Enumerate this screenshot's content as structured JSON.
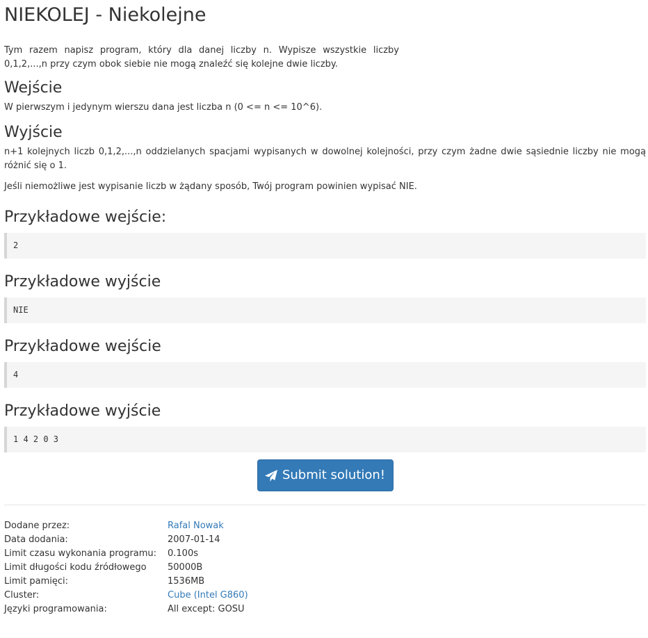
{
  "problem": {
    "title": "NIEKOLEJ - Niekolejne",
    "statement_line1": "Tym razem napisz program, który dla danej liczby n. Wypisze wszystkie liczby",
    "statement_line2": "0,1,2,...,n przy czym obok siebie nie mogą znaleźć się kolejne dwie liczby."
  },
  "input_section": {
    "heading": "Wejście",
    "text": "W pierwszym i jedynym wierszu dana jest liczba n (0 <= n <= 10^6)."
  },
  "output_section": {
    "heading": "Wyjście",
    "text1": "n+1 kolejnych liczb 0,1,2,...,n oddzielanych spacjami wypisanych w dowolnej kolejności, przy czym żadne dwie sąsiednie liczby nie mogą różnić się o 1.",
    "text2": "Jeśli niemożliwe jest wypisanie liczb w żądany sposób, Twój program powinien wypisać NIE."
  },
  "examples": [
    {
      "heading": "Przykładowe wejście:",
      "content": "2"
    },
    {
      "heading": "Przykładowe wyjście",
      "content": "NIE"
    },
    {
      "heading": "Przykładowe wejście",
      "content": "4"
    },
    {
      "heading": "Przykładowe wyjście",
      "content": "1 4 2 0 3"
    }
  ],
  "submit": {
    "label": "Submit solution!",
    "icon": "paper-plane-icon"
  },
  "meta": {
    "added_by_label": "Dodane przez:",
    "added_by_value": "Rafal Nowak",
    "date_label": "Data dodania:",
    "date_value": "2007-01-14",
    "time_limit_label": "Limit czasu wykonania programu:",
    "time_limit_value": "0.100s",
    "source_limit_label": "Limit długości kodu źródłowego",
    "source_limit_value": "50000B",
    "memory_limit_label": "Limit pamięci:",
    "memory_limit_value": "1536MB",
    "cluster_label": "Cluster:",
    "cluster_value": "Cube (Intel G860)",
    "languages_label": "Języki programowania:",
    "languages_value": "All except: GOSU"
  },
  "colors": {
    "link": "#337ab7",
    "button": "#337ab7",
    "text": "#333333",
    "pre_bg": "#f5f5f5"
  }
}
